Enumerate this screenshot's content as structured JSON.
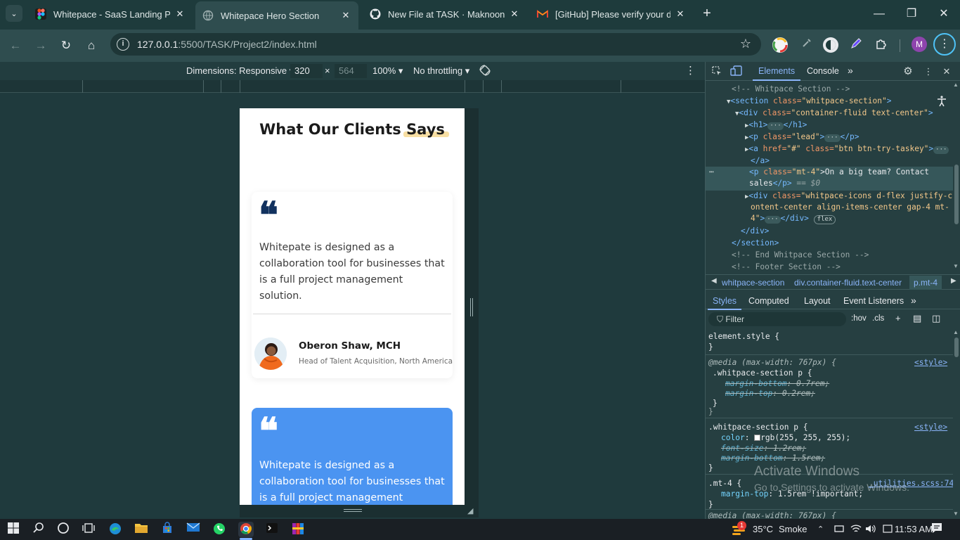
{
  "browser": {
    "tabs": [
      {
        "title": "Whitepace - SaaS Landing Page",
        "favicon": "figma-icon",
        "active": false
      },
      {
        "title": "Whitepace Hero Section",
        "favicon": "globe-icon",
        "active": true
      },
      {
        "title": "New File at TASK · Maknoon-Zia",
        "favicon": "github-icon",
        "active": false
      },
      {
        "title": "[GitHub] Please verify your device",
        "favicon": "gmail-icon",
        "active": false
      }
    ],
    "tab_search_icon": "⌄",
    "close_glyph": "✕",
    "new_tab_glyph": "+",
    "window_controls": {
      "minimize": "—",
      "maximize": "❐",
      "close": "✕"
    },
    "nav": {
      "back": "←",
      "forward": "→",
      "reload": "↻",
      "home": "⌂"
    },
    "url_host": "127.0.0.1",
    "url_path": ":5500/TASK/Project2/index.html",
    "profile_letter": "M",
    "bookmark_glyph": "☆",
    "menu_glyph": "⋮"
  },
  "device_toolbar": {
    "dimensions_label": "Dimensions: Responsive",
    "width": "320",
    "times": "×",
    "height": "564",
    "zoom": "100%",
    "throttling": "No throttling",
    "more_glyph": "⋮"
  },
  "page": {
    "section_title_pre": "What Our Clients ",
    "section_title_highlight": "Says",
    "quote_glyph": "❝",
    "cards": [
      {
        "quote": "Whitepate is designed as a collaboration tool for businesses that is a full project management solution.",
        "client_name": "Oberon Shaw, MCH",
        "client_role": "Head of Talent Acquisition, North America",
        "style": "white"
      },
      {
        "quote": "Whitepate is designed as a collaboration tool for businesses that is a full project management solution.",
        "style": "blue"
      }
    ]
  },
  "devtools": {
    "tabs": {
      "elements": "Elements",
      "console": "Console",
      "more": "»"
    },
    "dom": {
      "l1": "<!-- Whitpace Section -->",
      "l2_tag": "<section ",
      "l2_attr": "class=",
      "l2_val": "\"whitpace-section\"",
      "l2_end": ">",
      "l3_tag": "<div ",
      "l3_attr": "class=",
      "l3_val": "\"container-fluid text-center\"",
      "l3_end": ">",
      "l4": "<h1>",
      "l4_end": "</h1>",
      "l5_tag": "<p ",
      "l5_attr": "class=",
      "l5_val": "\"lead\"",
      "l5_end": "</p>",
      "l6_tag": "<a ",
      "l6_attr1": "href=",
      "l6_val1": "\"#\"",
      "l6_attr2": " class=",
      "l6_val2": "\"btn btn-try-taskey\"",
      "l7": "</a>",
      "l8_tag": "<p ",
      "l8_attr": "class=",
      "l8_val": "\"mt-4\"",
      "l8_text1": ">On a big team? Contact",
      "l8_text2": "sales",
      "l8_close": "</p>",
      "l8_eq": " == $0",
      "l9_tag": "<div ",
      "l9_attr": "class=",
      "l9_val1": "\"whitpace-icons d-flex justify-c",
      "l9_val2": "ontent-center align-items-center gap-4 mt-",
      "l9_val3": "4\"",
      "l9_close": "</div>",
      "flex_badge": "flex",
      "l10": "</div>",
      "l11": "</section>",
      "l12": "<!-- End Whitpace Section -->",
      "l13": "<!-- Footer Section -->"
    },
    "breadcrumbs": [
      "whitpace-section",
      "div.container-fluid.text-center",
      "p.mt-4"
    ],
    "styles_tabs": [
      "Styles",
      "Computed",
      "Layout",
      "Event Listeners",
      "»"
    ],
    "filter_placeholder": "Filter",
    "hov": ":hov",
    "cls": ".cls",
    "rules": {
      "element_style": "element.style {",
      "close": "}",
      "media1": "@media (max-width: 767px) {",
      "r1_sel": ".whitpace-section p {",
      "r1_p1": "margin-bottom",
      "r1_v1": ": 0.7rem;",
      "r1_p2": "margin-top",
      "r1_v2": ": 0.2rem;",
      "src_style": "<style>",
      "r2_sel": ".whitpace-section p {",
      "r2_p1": "color",
      "r2_v1": "rgb(255, 255, 255);",
      "r2_p2": "font-size",
      "r2_v2": ": 1.2rem;",
      "r2_p3": "margin-bottom",
      "r2_v3": ": 1.5rem;",
      "r3_sel": ".mt-4 {",
      "r3_src": "_utilities.scss:74",
      "r3_p1": "margin-top",
      "r3_v1": ": 1.5rem !important;",
      "media2": "@media (max-width: 767px) {"
    },
    "watermark_line1": "Activate Windows",
    "watermark_line2": "Go to Settings to activate Windows."
  },
  "taskbar": {
    "weather_temp": "35°C",
    "weather_text": "Smoke",
    "time": "11:53 AM",
    "notification_count": "1"
  }
}
